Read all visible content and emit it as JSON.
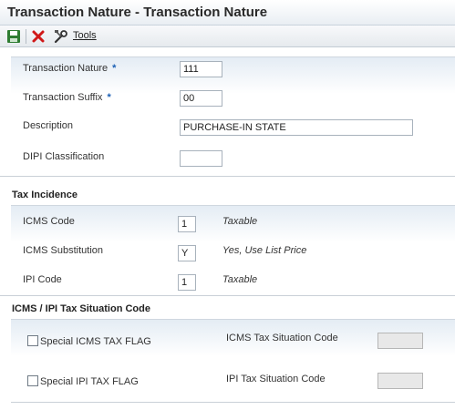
{
  "window": {
    "title": "Transaction Nature - Transaction Nature"
  },
  "toolbar": {
    "save_icon": "save-icon",
    "cancel_icon": "close-icon",
    "tools_icon": "tools-icon",
    "tools_label": "Tools"
  },
  "header_fields": {
    "transaction_nature": {
      "label": "Transaction Nature",
      "required_mark": "*",
      "value": "111"
    },
    "transaction_suffix": {
      "label": "Transaction Suffix",
      "required_mark": "*",
      "value": "00"
    },
    "description": {
      "label": "Description",
      "value": "PURCHASE-IN STATE"
    },
    "dipi_classification": {
      "label": "DIPI Classification",
      "value": ""
    }
  },
  "tax_incidence": {
    "title": "Tax Incidence",
    "icms_code": {
      "label": "ICMS Code",
      "value": "1",
      "description": "Taxable"
    },
    "icms_substitution": {
      "label": "ICMS Substitution",
      "value": "Y",
      "description": "Yes, Use List Price"
    },
    "ipi_code": {
      "label": "IPI Code",
      "value": "1",
      "description": "Taxable"
    }
  },
  "situation_code": {
    "title": "ICMS / IPI Tax Situation Code",
    "special_icms_flag": {
      "label": "Special ICMS TAX FLAG",
      "checked": false
    },
    "special_ipi_flag": {
      "label": "Special IPI TAX FLAG",
      "checked": false
    },
    "icms_tax_situation": {
      "label": "ICMS Tax Situation Code",
      "value": ""
    },
    "ipi_tax_situation": {
      "label": "IPI Tax Situation Code",
      "value": ""
    }
  },
  "colors": {
    "required_star": "#1a5fb4",
    "save_icon": "#2f7d32",
    "cancel_icon": "#d01818"
  }
}
